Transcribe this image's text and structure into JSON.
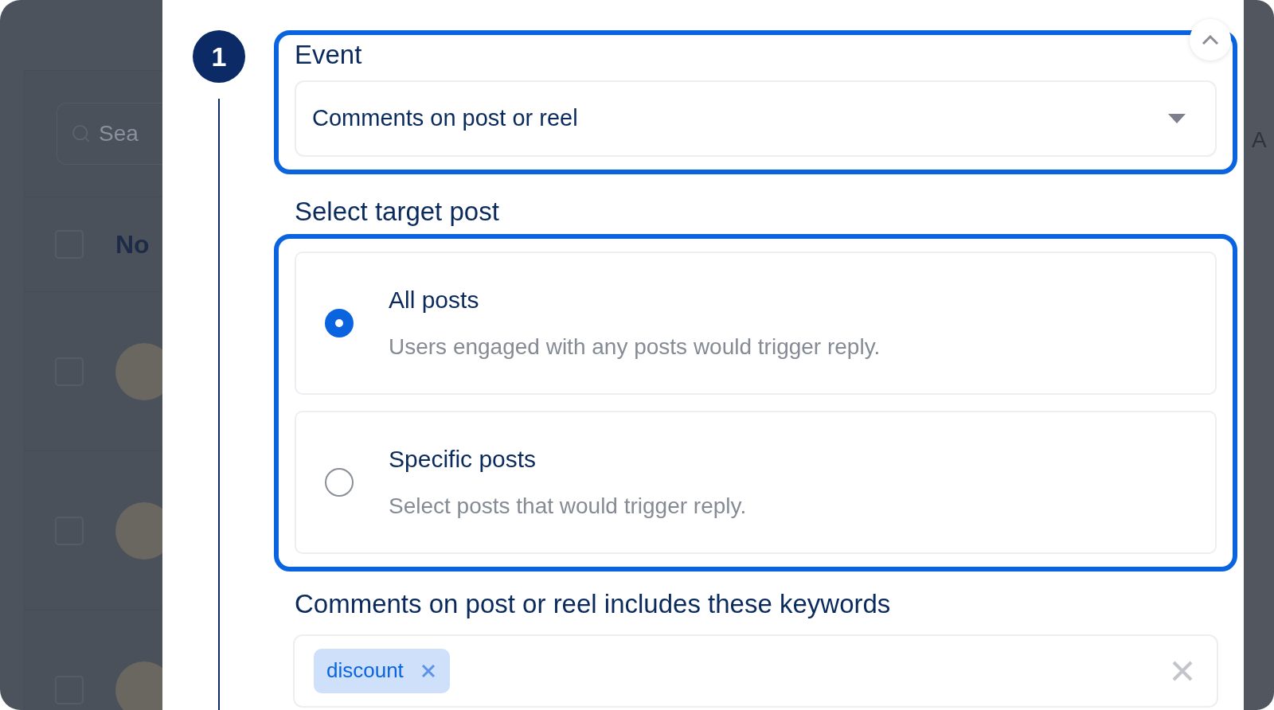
{
  "backdrop": {
    "search": {
      "placeholder": "Sea"
    },
    "header": {
      "checked": false,
      "label": "No"
    },
    "rows": [
      {
        "checked": false
      },
      {
        "checked": false
      },
      {
        "checked": false
      }
    ],
    "side_label": "A"
  },
  "modal": {
    "step": "1",
    "event": {
      "label": "Event",
      "value": "Comments on post or reel"
    },
    "target": {
      "label": "Select target post",
      "options": [
        {
          "title": "All posts",
          "description": "Users engaged with any posts would trigger reply.",
          "selected": true
        },
        {
          "title": "Specific posts",
          "description": "Select posts that would trigger reply.",
          "selected": false
        }
      ]
    },
    "keywords": {
      "label": "Comments on post or reel includes these keywords",
      "tags": [
        {
          "text": "discount"
        }
      ]
    }
  }
}
